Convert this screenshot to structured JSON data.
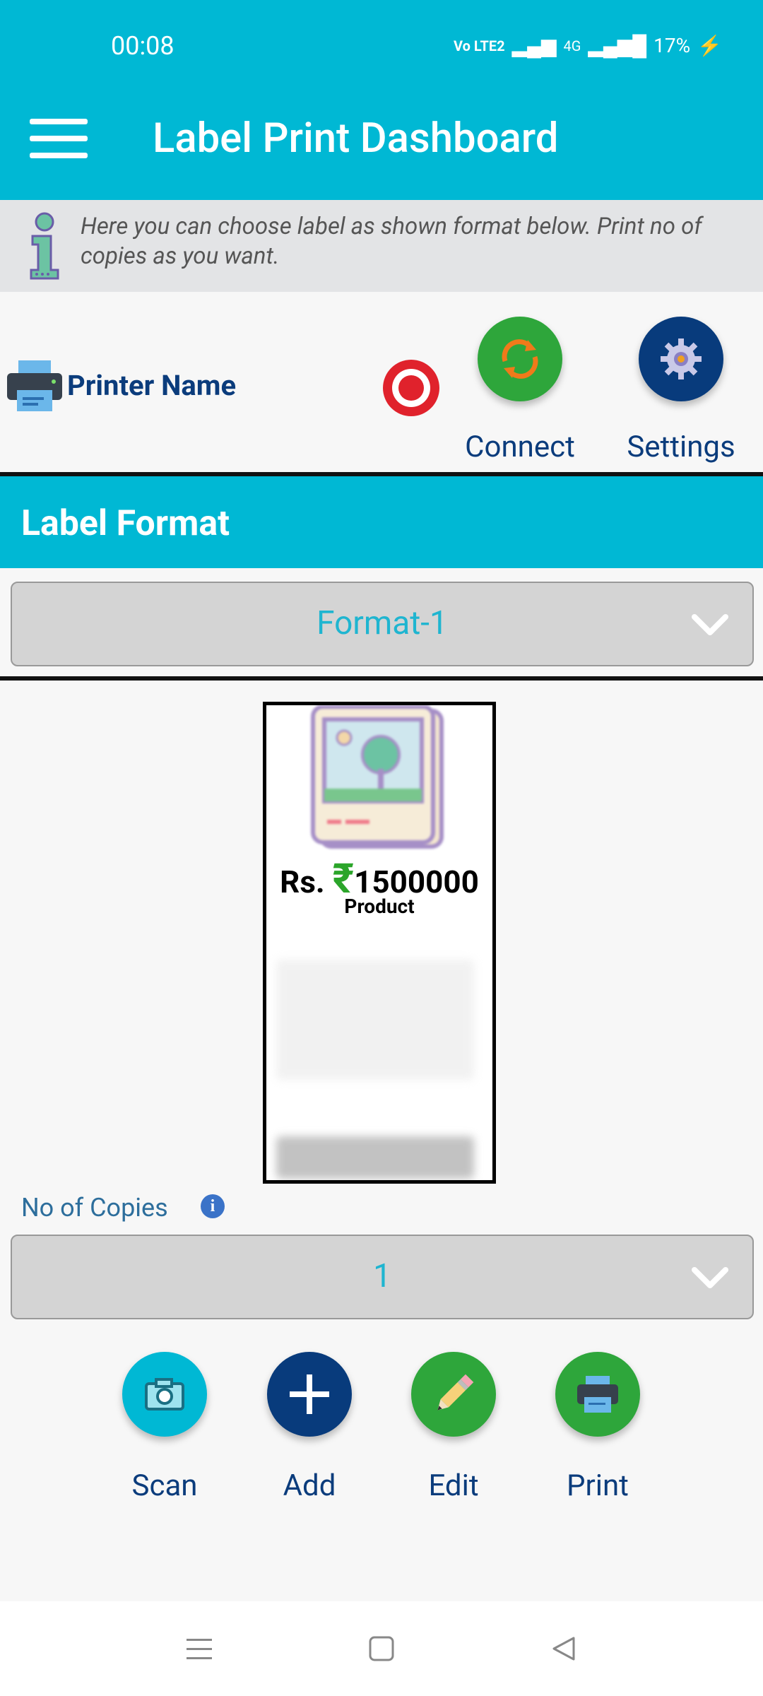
{
  "status_bar": {
    "time": "00:08",
    "network": "Vo LTE2",
    "data": "4G",
    "battery": "17%"
  },
  "app_bar": {
    "title": "Label Print Dashboard",
    "menu_icon": "hamburger-menu-icon"
  },
  "info": {
    "text": "Here you can choose label as shown format below. Print no of copies as you want."
  },
  "printer": {
    "name_label": "Printer Name",
    "status_color": "#e0222c",
    "connect_label": "Connect",
    "settings_label": "Settings"
  },
  "label_format": {
    "title": "Label Format",
    "selected": "Format-1"
  },
  "preview": {
    "price_prefix": "Rs.",
    "currency_symbol": "₹",
    "price": "1500000",
    "product": "Product"
  },
  "copies": {
    "label": "No of Copies",
    "info_icon": "i",
    "selected": "1"
  },
  "actions": [
    {
      "label": "Scan",
      "icon": "camera-icon",
      "color": "#00b8d4"
    },
    {
      "label": "Add",
      "icon": "plus-icon",
      "color": "#083b7c"
    },
    {
      "label": "Edit",
      "icon": "pencil-icon",
      "color": "#2ea63b"
    },
    {
      "label": "Print",
      "icon": "printer-icon",
      "color": "#2ea63b"
    }
  ],
  "colors": {
    "primary": "#00b8d4",
    "navy": "#0b3c7c",
    "green": "#2ea63b"
  }
}
